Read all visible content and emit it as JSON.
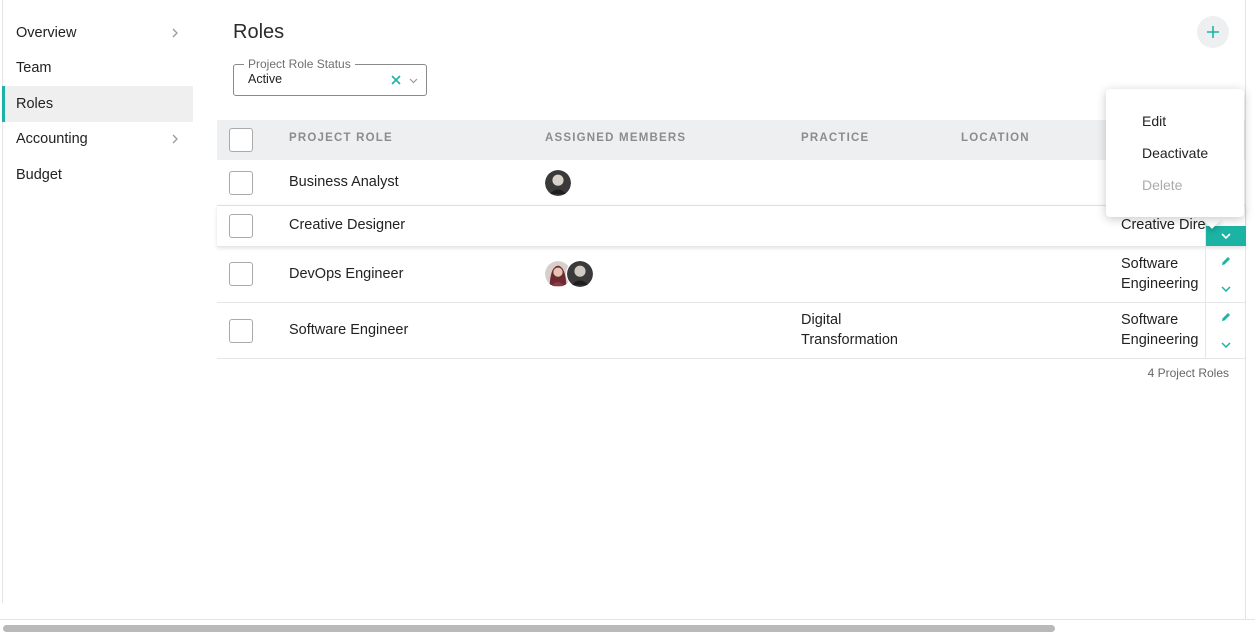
{
  "sidebar": {
    "items": [
      {
        "label": "Overview",
        "has_chevron": true
      },
      {
        "label": "Team",
        "has_chevron": false
      },
      {
        "label": "Roles",
        "has_chevron": false,
        "active": true
      },
      {
        "label": "Accounting",
        "has_chevron": true
      },
      {
        "label": "Budget",
        "has_chevron": false
      }
    ]
  },
  "header": {
    "title": "Roles",
    "add_icon": "plus-icon"
  },
  "filter": {
    "label": "Project Role Status",
    "value": "Active",
    "clear_icon": "close-icon",
    "caret_icon": "chevron-down-icon"
  },
  "table": {
    "columns": [
      "PROJECT ROLE",
      "ASSIGNED MEMBERS",
      "PRACTICE",
      "LOCATION"
    ],
    "rows": [
      {
        "role": "Business Analyst",
        "members": 1,
        "practice": "",
        "location": ""
      },
      {
        "role": "Creative Designer",
        "members": 0,
        "practice": "",
        "location": "Creative Direc"
      },
      {
        "role": "DevOps Engineer",
        "members": 2,
        "practice": "",
        "location_line1": "Software",
        "location_line2": "Engineering"
      },
      {
        "role": "Software Engineer",
        "members": 0,
        "practice_line1": "Digital",
        "practice_line2": "Transformation",
        "location_line1": "Software",
        "location_line2": "Engineering"
      }
    ],
    "footer_count": "4 Project Roles"
  },
  "row_menu": {
    "items": [
      {
        "label": "Edit",
        "enabled": true
      },
      {
        "label": "Deactivate",
        "enabled": true
      },
      {
        "label": "Delete",
        "enabled": false
      }
    ]
  },
  "colors": {
    "accent": "#1bb3a3",
    "header_bg": "#eeeff0",
    "active_nav_bg": "#efeff0"
  }
}
